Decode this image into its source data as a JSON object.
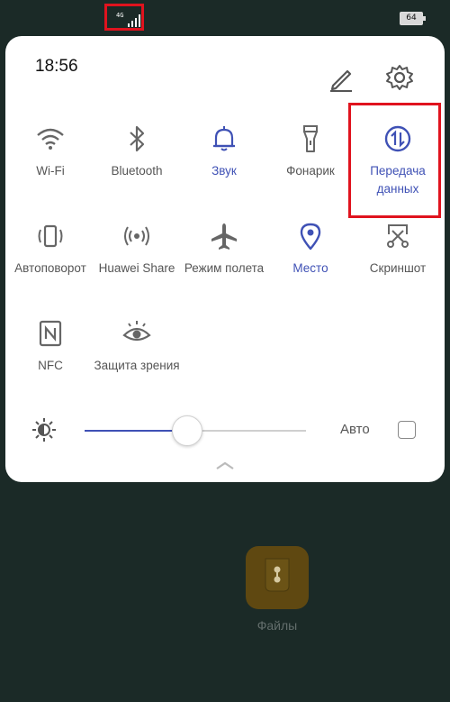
{
  "status_bar": {
    "network": "4G",
    "battery": "64"
  },
  "panel": {
    "time": "18:56",
    "edit_icon": "pencil-icon",
    "settings_icon": "gear-icon"
  },
  "toggles": [
    {
      "label": "Wi-Fi",
      "icon": "wifi-icon",
      "active": false
    },
    {
      "label": "Bluetooth",
      "icon": "bluetooth-icon",
      "active": false
    },
    {
      "label": "Звук",
      "icon": "bell-icon",
      "active": true
    },
    {
      "label": "Фонарик",
      "icon": "flashlight-icon",
      "active": false
    },
    {
      "label": "Передача данных",
      "icon": "mobile-data-icon",
      "active": true
    },
    {
      "label": "Автоповорот",
      "icon": "autorotate-icon",
      "active": false
    },
    {
      "label": "Huawei Share",
      "icon": "huawei-share-icon",
      "active": false
    },
    {
      "label": "Режим полета",
      "icon": "airplane-icon",
      "active": false
    },
    {
      "label": "Место",
      "icon": "location-icon",
      "active": true
    },
    {
      "label": "Скриншот",
      "icon": "screenshot-icon",
      "active": false
    },
    {
      "label": "NFC",
      "icon": "nfc-icon",
      "active": false
    },
    {
      "label": "Защита зрения",
      "icon": "eye-icon",
      "active": false
    }
  ],
  "brightness": {
    "level": 0.46,
    "auto_label": "Авто",
    "auto_checked": false
  },
  "home": {
    "app_label": "Файлы"
  },
  "colors": {
    "accent": "#3f51b5",
    "highlight": "#e0131e"
  }
}
